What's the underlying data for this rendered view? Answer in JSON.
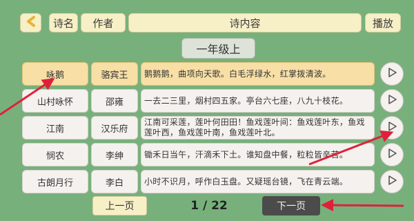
{
  "header": {
    "back_icon": "chevron-left-icon",
    "col_title": "诗名",
    "col_author": "作者",
    "col_content": "诗内容",
    "col_play": "播放"
  },
  "grade": "一年级上",
  "rows": [
    {
      "title": "咏鹅",
      "author": "骆宾王",
      "content": "鹅鹅鹅，曲项向天歌。白毛浮绿水，红掌拨清波。",
      "selected": true
    },
    {
      "title": "山村咏怀",
      "author": "邵雍",
      "content": "一去二三里，烟村四五家。亭台六七座，八九十枝花。",
      "selected": false
    },
    {
      "title": "江南",
      "author": "汉乐府",
      "content": "江南可采莲，莲叶何田田！鱼戏莲叶间：鱼戏莲叶东，鱼戏莲叶西，鱼戏莲叶南，鱼戏莲叶北。",
      "selected": false
    },
    {
      "title": "悯农",
      "author": "李绅",
      "content": "锄禾日当午，汗滴禾下土。谁知盘中餐，粒粒皆辛苦。",
      "selected": false
    },
    {
      "title": "古朗月行",
      "author": "李白",
      "content": "小时不识月，呼作白玉盘。又疑瑶台镜，飞在青云端。",
      "selected": false
    }
  ],
  "pagination": {
    "prev": "上一页",
    "page_text": "1 / 22",
    "next": "下一页"
  },
  "colors": {
    "background": "#78b07c",
    "header_bg": "#f7efc6",
    "selected_row": "#f7dfa6",
    "next_button": "#4b4b4b",
    "annotation_arrow": "#e0203a"
  }
}
